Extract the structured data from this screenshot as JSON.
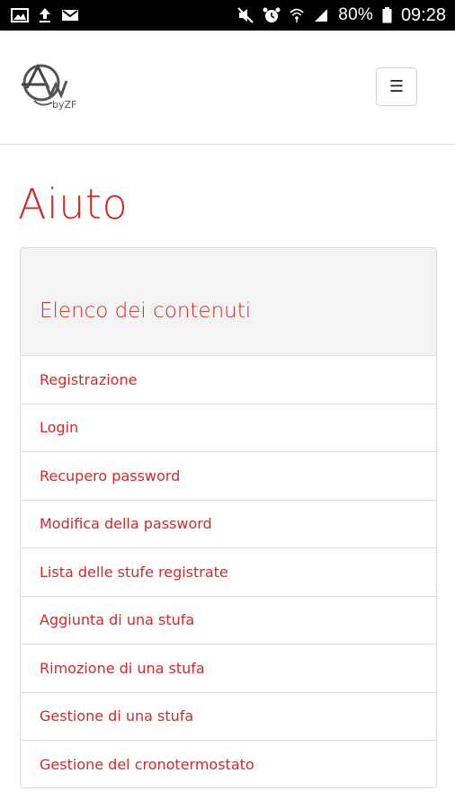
{
  "status_bar": {
    "battery_percent": "80%",
    "time": "09:28",
    "icons_left": [
      "image-icon",
      "upload-icon",
      "mail-icon"
    ],
    "icons_right": [
      "mute-icon",
      "alarm-icon",
      "wifi-icon",
      "signal-icon",
      "battery-icon"
    ]
  },
  "header": {
    "logo_text": "byZF",
    "menu_icon_glyph": "☰"
  },
  "page": {
    "title": "Aiuto"
  },
  "toc": {
    "heading": "Elenco dei contenuti",
    "items": [
      "Registrazione",
      "Login",
      "Recupero password",
      "Modifica della password",
      "Lista delle stufe registrate",
      "Aggiunta di una stufa",
      "Rimozione di una stufa",
      "Gestione di una stufa",
      "Gestione del cronotermostato"
    ]
  },
  "colors": {
    "accent": "#cf2a2a",
    "status_bar_bg": "#000000",
    "panel_heading_bg": "#f4f4f4",
    "border": "#dcdcdc"
  }
}
